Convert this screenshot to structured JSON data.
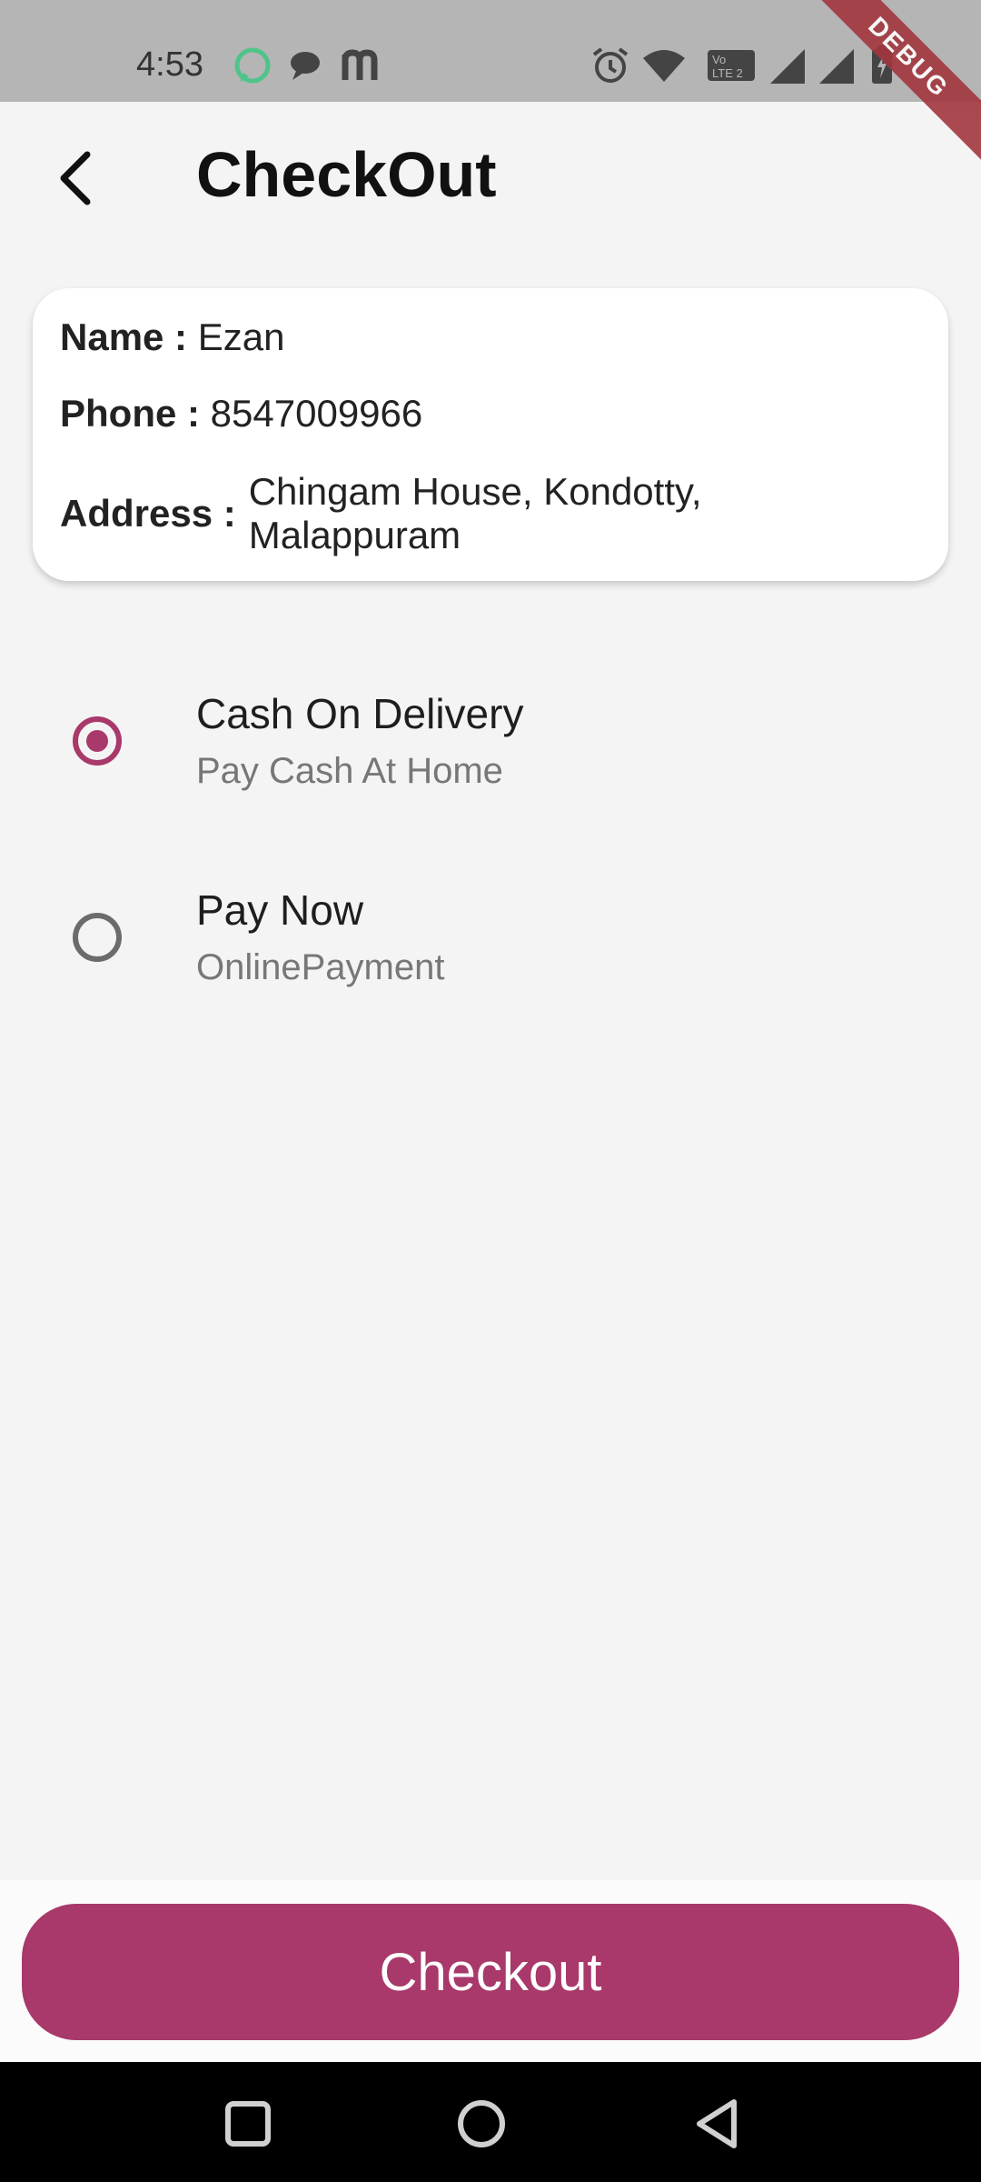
{
  "status_bar": {
    "time": "4:53"
  },
  "debug_banner": "DEBUG",
  "header": {
    "title": "CheckOut"
  },
  "customer": {
    "name_label": "Name :",
    "name": "Ezan",
    "phone_label": "Phone :",
    "phone": "8547009966",
    "address_label": "Address :",
    "address": "Chingam House, Kondotty, Malappuram"
  },
  "payment_options": [
    {
      "title": "Cash On Delivery",
      "subtitle": "Pay Cash At Home",
      "selected": true
    },
    {
      "title": "Pay Now",
      "subtitle": "OnlinePayment",
      "selected": false
    }
  ],
  "checkout_button": "Checkout",
  "colors": {
    "accent": "#a8396a",
    "status_bar": "#b5b5b5",
    "background": "#f4f4f4"
  },
  "icons": [
    "back-arrow-icon",
    "whatsapp-icon",
    "chat-icon",
    "m-app-icon",
    "alarm-icon",
    "wifi-icon",
    "volte-icon",
    "signal-icon",
    "battery-icon",
    "square-nav-icon",
    "circle-nav-icon",
    "triangle-back-nav-icon"
  ]
}
